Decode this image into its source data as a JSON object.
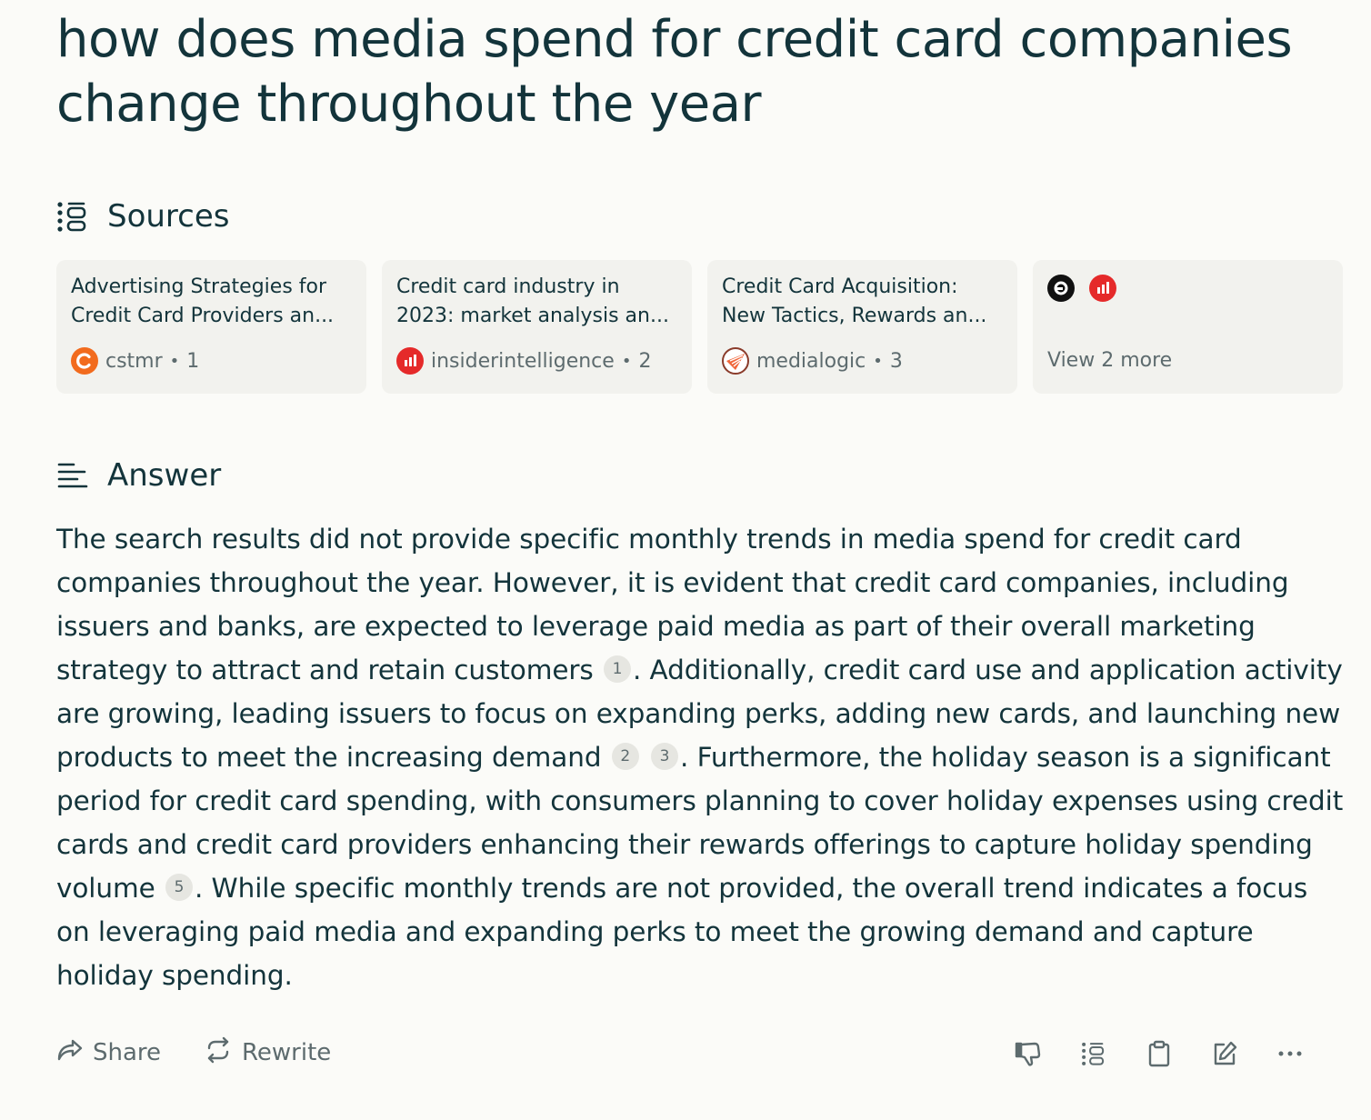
{
  "query": "how does media spend for credit card companies change throughout the year",
  "sources_section": {
    "label": "Sources"
  },
  "sources": [
    {
      "title": "Advertising Strategies for Credit Card Providers an...",
      "site": "cstmr",
      "index": "1",
      "icon": "cstmr-logo-icon"
    },
    {
      "title": "Credit card industry in 2023: market analysis an...",
      "site": "insiderintelligence",
      "index": "2",
      "icon": "insiderintelligence-logo-icon"
    },
    {
      "title": "Credit Card Acquisition: New Tactics, Rewards an...",
      "site": "medialogic",
      "index": "3",
      "icon": "medialogic-logo-icon"
    }
  ],
  "more_sources": {
    "label": "View 2 more",
    "icons": [
      "source-logo-icon",
      "insiderintelligence-logo-icon"
    ]
  },
  "answer_section": {
    "label": "Answer"
  },
  "answer": {
    "p1": "The search results did not provide specific monthly trends in media spend for credit card companies throughout the year. However, it is evident that credit card companies, including issuers and banks, are expected to leverage paid media as part of their overall marketing strategy to attract and retain customers",
    "c1": "1",
    "p2": ". Additionally, credit card use and application activity are growing, leading issuers to focus on expanding perks, adding new cards, and launching new products to meet the increasing demand",
    "c2": "2",
    "c3": "3",
    "p3": ". Furthermore, the holiday season is a significant period for credit card spending, with consumers planning to cover holiday expenses using credit cards and credit card providers enhancing their rewards offerings to capture holiday spending volume",
    "c5": "5",
    "p4": ". While specific monthly trends are not provided, the overall trend indicates a focus on leveraging paid media and expanding perks to meet the growing demand and capture holiday spending."
  },
  "footer": {
    "share_label": "Share",
    "rewrite_label": "Rewrite",
    "icons": [
      "thumbs-down-icon",
      "sources-list-icon",
      "clipboard-icon",
      "edit-icon",
      "more-options-icon"
    ]
  },
  "colors": {
    "text": "#13343b",
    "muted": "#5d6b6e",
    "card_bg": "#f2f2ee",
    "page_bg": "#fbfbf8"
  }
}
